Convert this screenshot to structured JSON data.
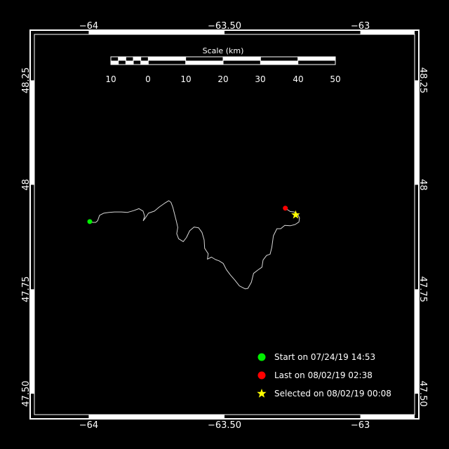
{
  "map": {
    "background_color": "#000000",
    "frame_color": "#ffffff",
    "track_color": "#d8d8d8",
    "lon_range": [
      -64.2,
      -62.8
    ],
    "lat_range": [
      47.45,
      48.36
    ],
    "lon_ticks": [
      {
        "value": -64,
        "label": "−64"
      },
      {
        "value": -63.5,
        "label": "−63.50"
      },
      {
        "value": -63,
        "label": "−63"
      }
    ],
    "lat_ticks": [
      {
        "value": 47.5,
        "label": "47.50"
      },
      {
        "value": 47.75,
        "label": "47.75"
      },
      {
        "value": 48,
        "label": "48"
      },
      {
        "value": 48.25,
        "label": "48.25"
      }
    ]
  },
  "scale_bar": {
    "title": "Scale (km)",
    "labels": [
      "10",
      "0",
      "10",
      "20",
      "30",
      "40",
      "50"
    ]
  },
  "track": {
    "points": [
      [
        -63.996,
        47.912
      ],
      [
        -63.985,
        47.91
      ],
      [
        -63.974,
        47.91
      ],
      [
        -63.967,
        47.914
      ],
      [
        -63.96,
        47.927
      ],
      [
        -63.945,
        47.932
      ],
      [
        -63.925,
        47.934
      ],
      [
        -63.905,
        47.935
      ],
      [
        -63.88,
        47.935
      ],
      [
        -63.857,
        47.934
      ],
      [
        -63.835,
        47.938
      ],
      [
        -63.815,
        47.943
      ],
      [
        -63.8,
        47.937
      ],
      [
        -63.794,
        47.925
      ],
      [
        -63.799,
        47.914
      ],
      [
        -63.79,
        47.922
      ],
      [
        -63.78,
        47.932
      ],
      [
        -63.758,
        47.937
      ],
      [
        -63.74,
        47.947
      ],
      [
        -63.72,
        47.956
      ],
      [
        -63.705,
        47.962
      ],
      [
        -63.697,
        47.958
      ],
      [
        -63.69,
        47.946
      ],
      [
        -63.684,
        47.93
      ],
      [
        -63.677,
        47.912
      ],
      [
        -63.672,
        47.898
      ],
      [
        -63.676,
        47.883
      ],
      [
        -63.669,
        47.871
      ],
      [
        -63.652,
        47.864
      ],
      [
        -63.64,
        47.874
      ],
      [
        -63.628,
        47.89
      ],
      [
        -63.612,
        47.899
      ],
      [
        -63.595,
        47.897
      ],
      [
        -63.583,
        47.886
      ],
      [
        -63.575,
        47.868
      ],
      [
        -63.573,
        47.848
      ],
      [
        -63.56,
        47.835
      ],
      [
        -63.563,
        47.822
      ],
      [
        -63.548,
        47.827
      ],
      [
        -63.533,
        47.821
      ],
      [
        -63.52,
        47.818
      ],
      [
        -63.505,
        47.812
      ],
      [
        -63.493,
        47.797
      ],
      [
        -63.478,
        47.784
      ],
      [
        -63.462,
        47.772
      ],
      [
        -63.445,
        47.758
      ],
      [
        -63.424,
        47.751
      ],
      [
        -63.414,
        47.752
      ],
      [
        -63.401,
        47.767
      ],
      [
        -63.393,
        47.788
      ],
      [
        -63.377,
        47.796
      ],
      [
        -63.362,
        47.803
      ],
      [
        -63.358,
        47.82
      ],
      [
        -63.345,
        47.831
      ],
      [
        -63.332,
        47.834
      ],
      [
        -63.326,
        47.85
      ],
      [
        -63.32,
        47.878
      ],
      [
        -63.307,
        47.895
      ],
      [
        -63.293,
        47.895
      ],
      [
        -63.278,
        47.903
      ],
      [
        -63.258,
        47.902
      ],
      [
        -63.24,
        47.905
      ],
      [
        -63.226,
        47.911
      ],
      [
        -63.224,
        47.921
      ],
      [
        -63.231,
        47.93
      ],
      [
        -63.244,
        47.935
      ],
      [
        -63.258,
        47.936
      ],
      [
        -63.276,
        47.944
      ]
    ],
    "start": {
      "lon": -63.996,
      "lat": 47.912,
      "color": "#00ee00"
    },
    "last": {
      "lon": -63.276,
      "lat": 47.944,
      "color": "#ff0000"
    },
    "selected": {
      "lon": -63.238,
      "lat": 47.928,
      "color": "#ffff00"
    }
  },
  "legend": {
    "start": {
      "label": "Start on 07/24/19 14:53",
      "color": "#00ee00"
    },
    "last": {
      "label": "Last on 08/02/19 02:38",
      "color": "#ff0000"
    },
    "selected": {
      "label": "Selected on 08/02/19 00:08",
      "color": "#ffff00"
    }
  }
}
